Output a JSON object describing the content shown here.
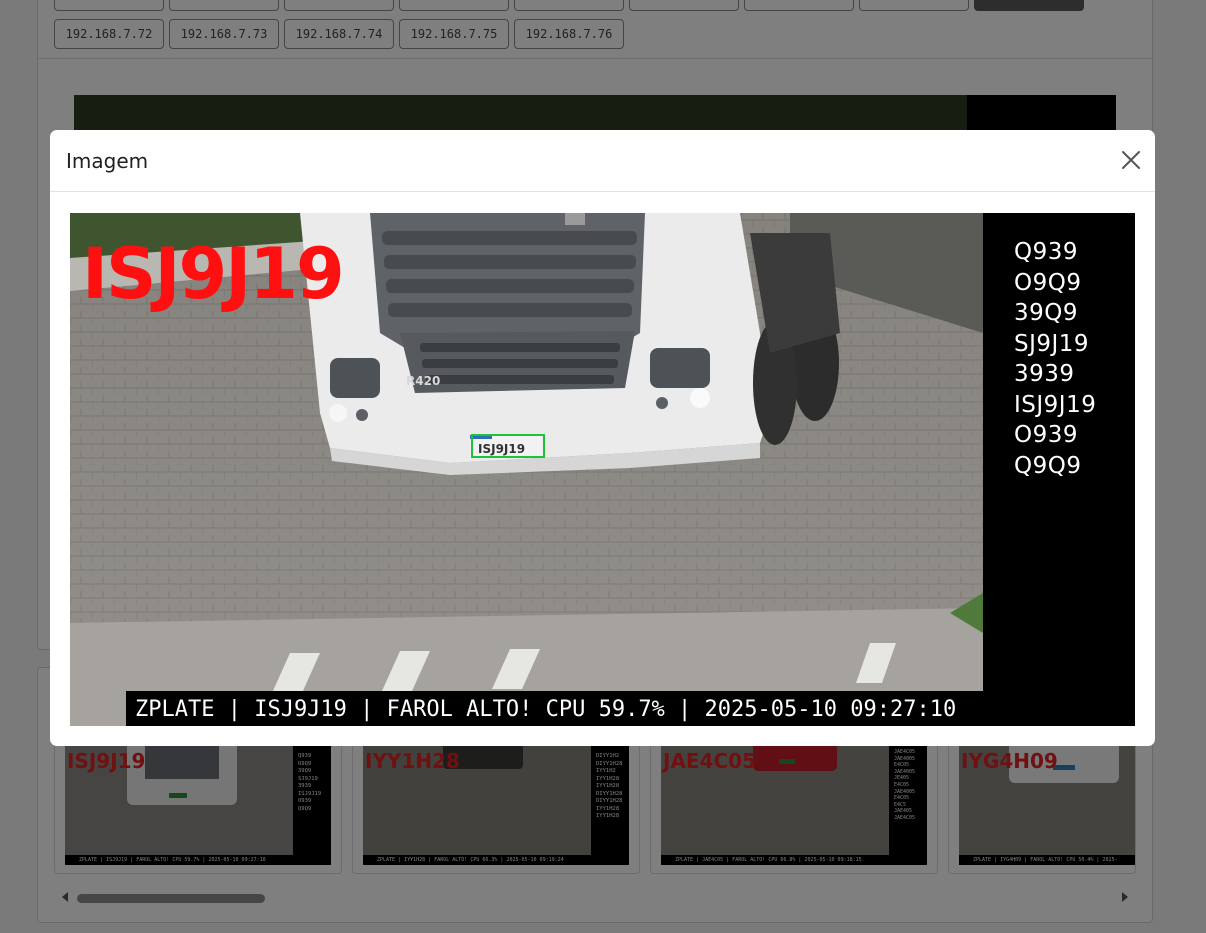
{
  "camera_buttons": {
    "row1": [
      "",
      "",
      "",
      "",
      "",
      "",
      "",
      "",
      ""
    ],
    "row2": [
      "192.168.7.72",
      "192.168.7.73",
      "192.168.7.74",
      "192.168.7.75",
      "192.168.7.76"
    ]
  },
  "modal": {
    "title": "Imagem",
    "image": {
      "plate": "ISJ9J19",
      "small_plate": "ISJ9J19",
      "truck_model": "R420",
      "readings": [
        "Q939",
        "O9Q9",
        "39Q9",
        "SJ9J19",
        "3939",
        "ISJ9J19",
        "O939",
        "Q9Q9"
      ],
      "status_line": "ZPLATE | ISJ9J19 | FAROL ALTO! CPU 59.7% | 2025-05-10 09:27:10"
    }
  },
  "gallery": [
    {
      "plate": "ISJ9J19",
      "footer": "ZPLATE | ISJ9J19 | FAROL ALTO! CPU 59.7% | 2025-05-10 09:27:10",
      "side": "Q939\nO9Q9\n39Q9\nSJ9J19\n3939\nISJ9J19\nO939\nQ9Q9",
      "truck_color": "#e8e8e8"
    },
    {
      "plate": "IYY1H28",
      "footer": "ZPLATE | IYY1H28 | FAROL ALTO! CPU 66.3% | 2025-05-10 09:19:24",
      "side": "DIYY1H2\nDIYY1H28\nIYY1H2\nIYY1H28\nIYY1H28\nDIYY1H28\nDIYY1H28\nIYY1H28\nIYY1H28",
      "truck_color": "#3a3a36"
    },
    {
      "plate": "JAE4C05",
      "footer": "ZPLATE | JAE4C05 | FAROL ALTO! CPU 66.8% | 2025-05-10 09:18:15",
      "side": "JAE4C05\nJAE4005\nE4C05\nJAE4005\nJE405\nE4C05\nJAE4005\nE4C05\nE4C5\nJAE405\nJAE4C05",
      "truck_color": "#c21f2a"
    },
    {
      "plate": "IYG4H09",
      "footer": "ZPLATE | IYG4H09 | FAROL ALTO! CPU 50.4% | 2025-",
      "side": "",
      "truck_color": "#f2f2f2"
    }
  ]
}
